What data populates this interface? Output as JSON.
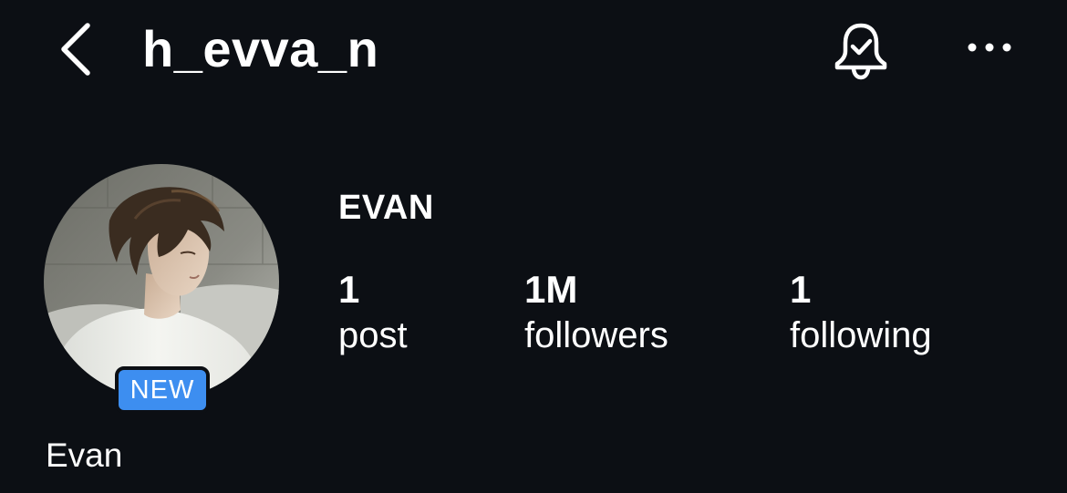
{
  "header": {
    "username": "h_evva_n",
    "back_icon": "chevron-left-icon",
    "notification_icon": "bell-check-icon",
    "more_icon": "ellipsis-horizontal-icon"
  },
  "profile": {
    "name": "EVAN",
    "display_name": "Evan",
    "avatar_badge": "NEW",
    "badge_color": "#3d8ef0",
    "stats": [
      {
        "value": "1",
        "label": "post"
      },
      {
        "value": "1M",
        "label": "followers"
      },
      {
        "value": "1",
        "label": "following"
      }
    ]
  },
  "theme": {
    "background": "#0c0f14",
    "text": "#ffffff"
  }
}
